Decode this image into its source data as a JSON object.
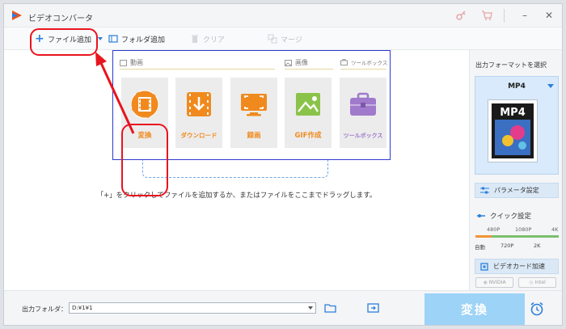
{
  "window": {
    "title": "ビデオコンバータ"
  },
  "toolbar": {
    "add_file": "ファイル追加",
    "add_folder": "フォルダ追加",
    "clear": "クリア",
    "merge": "マージ"
  },
  "sections": {
    "video": "動画",
    "image": "画像",
    "toolbox": "ツールボックス"
  },
  "tiles": [
    {
      "label": "変換"
    },
    {
      "label": "ダウンロード"
    },
    {
      "label": "録画"
    },
    {
      "label": "GIF作成"
    },
    {
      "label": "ツールボックス"
    }
  ],
  "hint": "「+」をクリックしてファイルを追加するか、またはファイルをここまでドラッグします。",
  "right_panel": {
    "format_heading": "出力フォーマットを選択",
    "format_name": "MP4",
    "format_icon_text": "MP4",
    "param_button": "パラメータ設定",
    "quick_label": "クイック設定",
    "quick_top": [
      "480P",
      "1080P",
      "4K"
    ],
    "quick_bottom": [
      "自動",
      "720P",
      "2K"
    ],
    "gpu_button": "ビデオカード加速",
    "hw": [
      "NVIDIA",
      "Intel"
    ]
  },
  "bottom": {
    "output_label": "出力フォルダ：",
    "output_path": "D:¥1¥1",
    "convert": "変換"
  },
  "colors": {
    "accent_orange": "#f08a1e",
    "annotation_red": "#e8141e",
    "frame_blue": "#2c3ad0",
    "convert_button": "#9dd3f7"
  }
}
